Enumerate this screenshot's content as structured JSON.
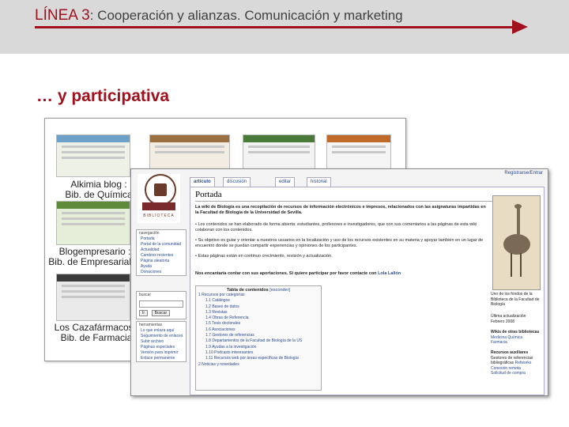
{
  "header": {
    "title_lead": "LÍNEA 3",
    "title_rest": ": Cooperación y alianzas. Comunicación y marketing",
    "accent_color": "#a0101d",
    "band_color": "#d9d9d9",
    "arrow_icon": "right-arrow"
  },
  "subtitle": "… y participativa",
  "collage": {
    "captions": [
      {
        "line1": "Alkimia blog :",
        "line2": "Bib. de Química"
      },
      {
        "line1": "Blogempresario :",
        "line2": "Bib. de Empresariales"
      },
      {
        "line1": "Los Cazafármacos :",
        "line2": "Bib. de Farmacia"
      }
    ]
  },
  "wiki": {
    "user_links": "Registrarse/Entrar",
    "logo_text": "BIBLIOTECA",
    "tabs": [
      "artículo",
      "discusión",
      "editar",
      "historial"
    ],
    "page_title": "Portada",
    "intro": "La wiki de Biología es una recopilación de recursos de información electrónicos e impresos, relacionados con las asignaturas impartidas en la Facultad de Biología de la Universidad de Sevilla.",
    "bullets": [
      "Los contenidos se han elaborado de forma abierta: estudiantes, profesores e investigadores, que con sus comentarios a las páginas de esta wiki colaboran con los contenidos.",
      "Su objetivo es guiar y orientar a nuestros usuarios en la localización y uso de los recursos existentes en su materia y apoyar también en un lugar de encuentro donde se puedan compartir experiencias y opiniones de los participantes.",
      "Estas páginas están en continuo crecimiento, revisión y actualización."
    ],
    "invite": "Nos encantaría contar con sus aportaciones. Si quiere participar por favor contacte con",
    "invite_link": "Lola Lallón",
    "nav_title": "navegación",
    "nav_items": [
      "Portada",
      "Portal de la comunidad",
      "Actualidad",
      "Cambios recientes",
      "Página aleatoria",
      "Ayuda",
      "Donaciones"
    ],
    "search_title": "buscar",
    "search_buttons": [
      "Ir",
      "Buscar"
    ],
    "tools_title": "herramientas",
    "tools_items": [
      "Lo que enlaza aquí",
      "Seguimiento de enlaces",
      "Subir archivo",
      "Páginas especiales",
      "Versión para imprimir",
      "Enlace permanente"
    ],
    "toc_title": "Tabla de contenidos",
    "toc_toggle": "[esconder]",
    "toc_items": [
      "1 Recursos por categorías",
      "1.1 Catálogos",
      "1.2 Bases de datos",
      "1.3 Revistas",
      "1.4 Obras de Referencia",
      "1.5 Tesis doctorales",
      "1.6 Asociaciones",
      "1.7 Gestores de referencias",
      "1.8 Departamentos de la Facultad de Biología de la US",
      "1.9 Ayudas a la investigación",
      "1.10 Podcasts interesantes",
      "1.11 Recursos web por áreas específicas de Biología",
      "2 Noticias y novedades"
    ],
    "right_caption": "Uno de los fondos de la Biblioteca de la Facultad de Biología",
    "right_update_label": "Última actualización",
    "right_update_date": "Febrero 2008",
    "right_links_title": "Wikis de otras bibliotecas",
    "right_links": [
      "Medicina",
      "Química",
      "Farmacia"
    ],
    "right_aux_title": "Recursos auxiliares",
    "right_aux_text": "Gestores de referencias bibliográficas",
    "right_aux_link": "Refworks",
    "right_aux_items": [
      "Conexión remota",
      "Solicitud de compra"
    ]
  }
}
